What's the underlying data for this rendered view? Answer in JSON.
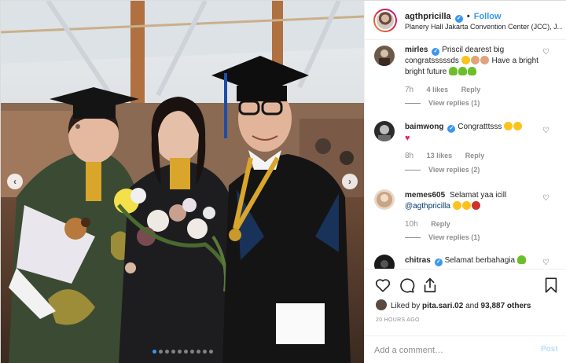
{
  "post": {
    "username": "agthpricilla",
    "follow_label": "Follow",
    "separator": "•",
    "location": "Planery Hall Jakarta Convention Center (JCC), J...",
    "verified_glyph": "✓"
  },
  "photo": {
    "carousel_count": 10,
    "active_index": 0,
    "prev_glyph": "‹",
    "next_glyph": "›"
  },
  "comments": [
    {
      "username": "mirles",
      "verified": true,
      "text_parts": [
        "Priscil dearest big congratsssssds ",
        "Have a bright bright future "
      ],
      "time": "7h",
      "likes": "4 likes",
      "reply": "Reply",
      "view_replies": "View replies (1)",
      "avatar_color": "#6b5a4a"
    },
    {
      "username": "baimwong",
      "verified": true,
      "text_parts": [
        "Congratttsss "
      ],
      "time": "8h",
      "likes": "13 likes",
      "reply": "Reply",
      "view_replies": "View replies (2)",
      "avatar_color": "#2b2b2b"
    },
    {
      "username": "memes605",
      "verified": false,
      "text_parts": [
        "Selamat yaa icill "
      ],
      "mention": "@agthpricilla",
      "time": "10h",
      "reply": "Reply",
      "view_replies": "View replies (1)",
      "avatar_color": "#c9a585"
    },
    {
      "username": "chitras",
      "verified": true,
      "text_parts": [
        "Selamat berbahagia "
      ],
      "avatar_color": "#1a1a1a"
    }
  ],
  "actions": {
    "icons": [
      "heart-icon",
      "comment-icon",
      "share-icon",
      "bookmark-icon"
    ],
    "liked_by_prefix": "Liked by ",
    "liked_by_user": "pita.sari.02",
    "liked_by_mid": " and ",
    "liked_by_count": "93,887 others",
    "timestamp": "20 HOURS AGO",
    "comment_placeholder": "Add a comment…",
    "post_label": "Post"
  },
  "colors": {
    "accent": "#3897f0",
    "link": "#00376b",
    "muted": "#8e8e8e",
    "border": "#efefef"
  }
}
